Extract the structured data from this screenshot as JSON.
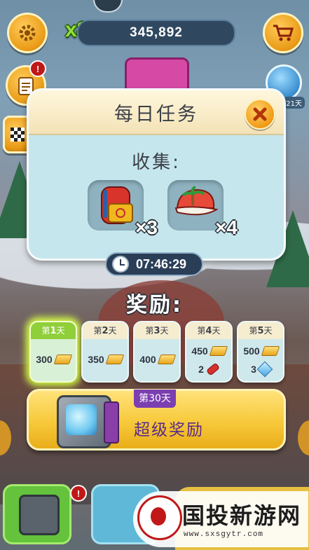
{
  "hud": {
    "multiplier": "x86",
    "score": "345,892",
    "notification_mark": "!",
    "gem_days_label": "21天"
  },
  "mission": {
    "title": "每日任务",
    "collect_label": "收集:",
    "items": [
      {
        "icon": "backpack-icon",
        "count": "×3"
      },
      {
        "icon": "cap-icon",
        "count": "×4"
      }
    ],
    "timer": "07:46:29"
  },
  "rewards": {
    "label": "奖励:",
    "days": [
      {
        "prefix": "第",
        "num": "1",
        "suffix": "天",
        "rows": [
          {
            "amount": "300",
            "icon": "gold-bar"
          }
        ],
        "active": true
      },
      {
        "prefix": "第",
        "num": "2",
        "suffix": "天",
        "rows": [
          {
            "amount": "350",
            "icon": "gold-bar"
          }
        ]
      },
      {
        "prefix": "第",
        "num": "3",
        "suffix": "天",
        "rows": [
          {
            "amount": "400",
            "icon": "gold-bar"
          }
        ]
      },
      {
        "prefix": "第",
        "num": "4",
        "suffix": "天",
        "rows": [
          {
            "amount": "450",
            "icon": "gold-bar"
          },
          {
            "amount": "2",
            "icon": "rocket"
          }
        ]
      },
      {
        "prefix": "第",
        "num": "5",
        "suffix": "天",
        "rows": [
          {
            "amount": "500",
            "icon": "gold-bar"
          },
          {
            "amount": "3",
            "icon": "gem"
          }
        ]
      }
    ],
    "super": {
      "day_tag": "第30天",
      "label": "超级奖励"
    }
  },
  "watermark": {
    "title": "国投新游网",
    "url": "www.sxsgytr.com"
  },
  "colors": {
    "accent_orange": "#f09a16",
    "panel_bg": "#c6e6ed",
    "active_glow": "#d6ff46",
    "super_banner": "#f7c93a",
    "purple_tag": "#7b3fb0"
  }
}
